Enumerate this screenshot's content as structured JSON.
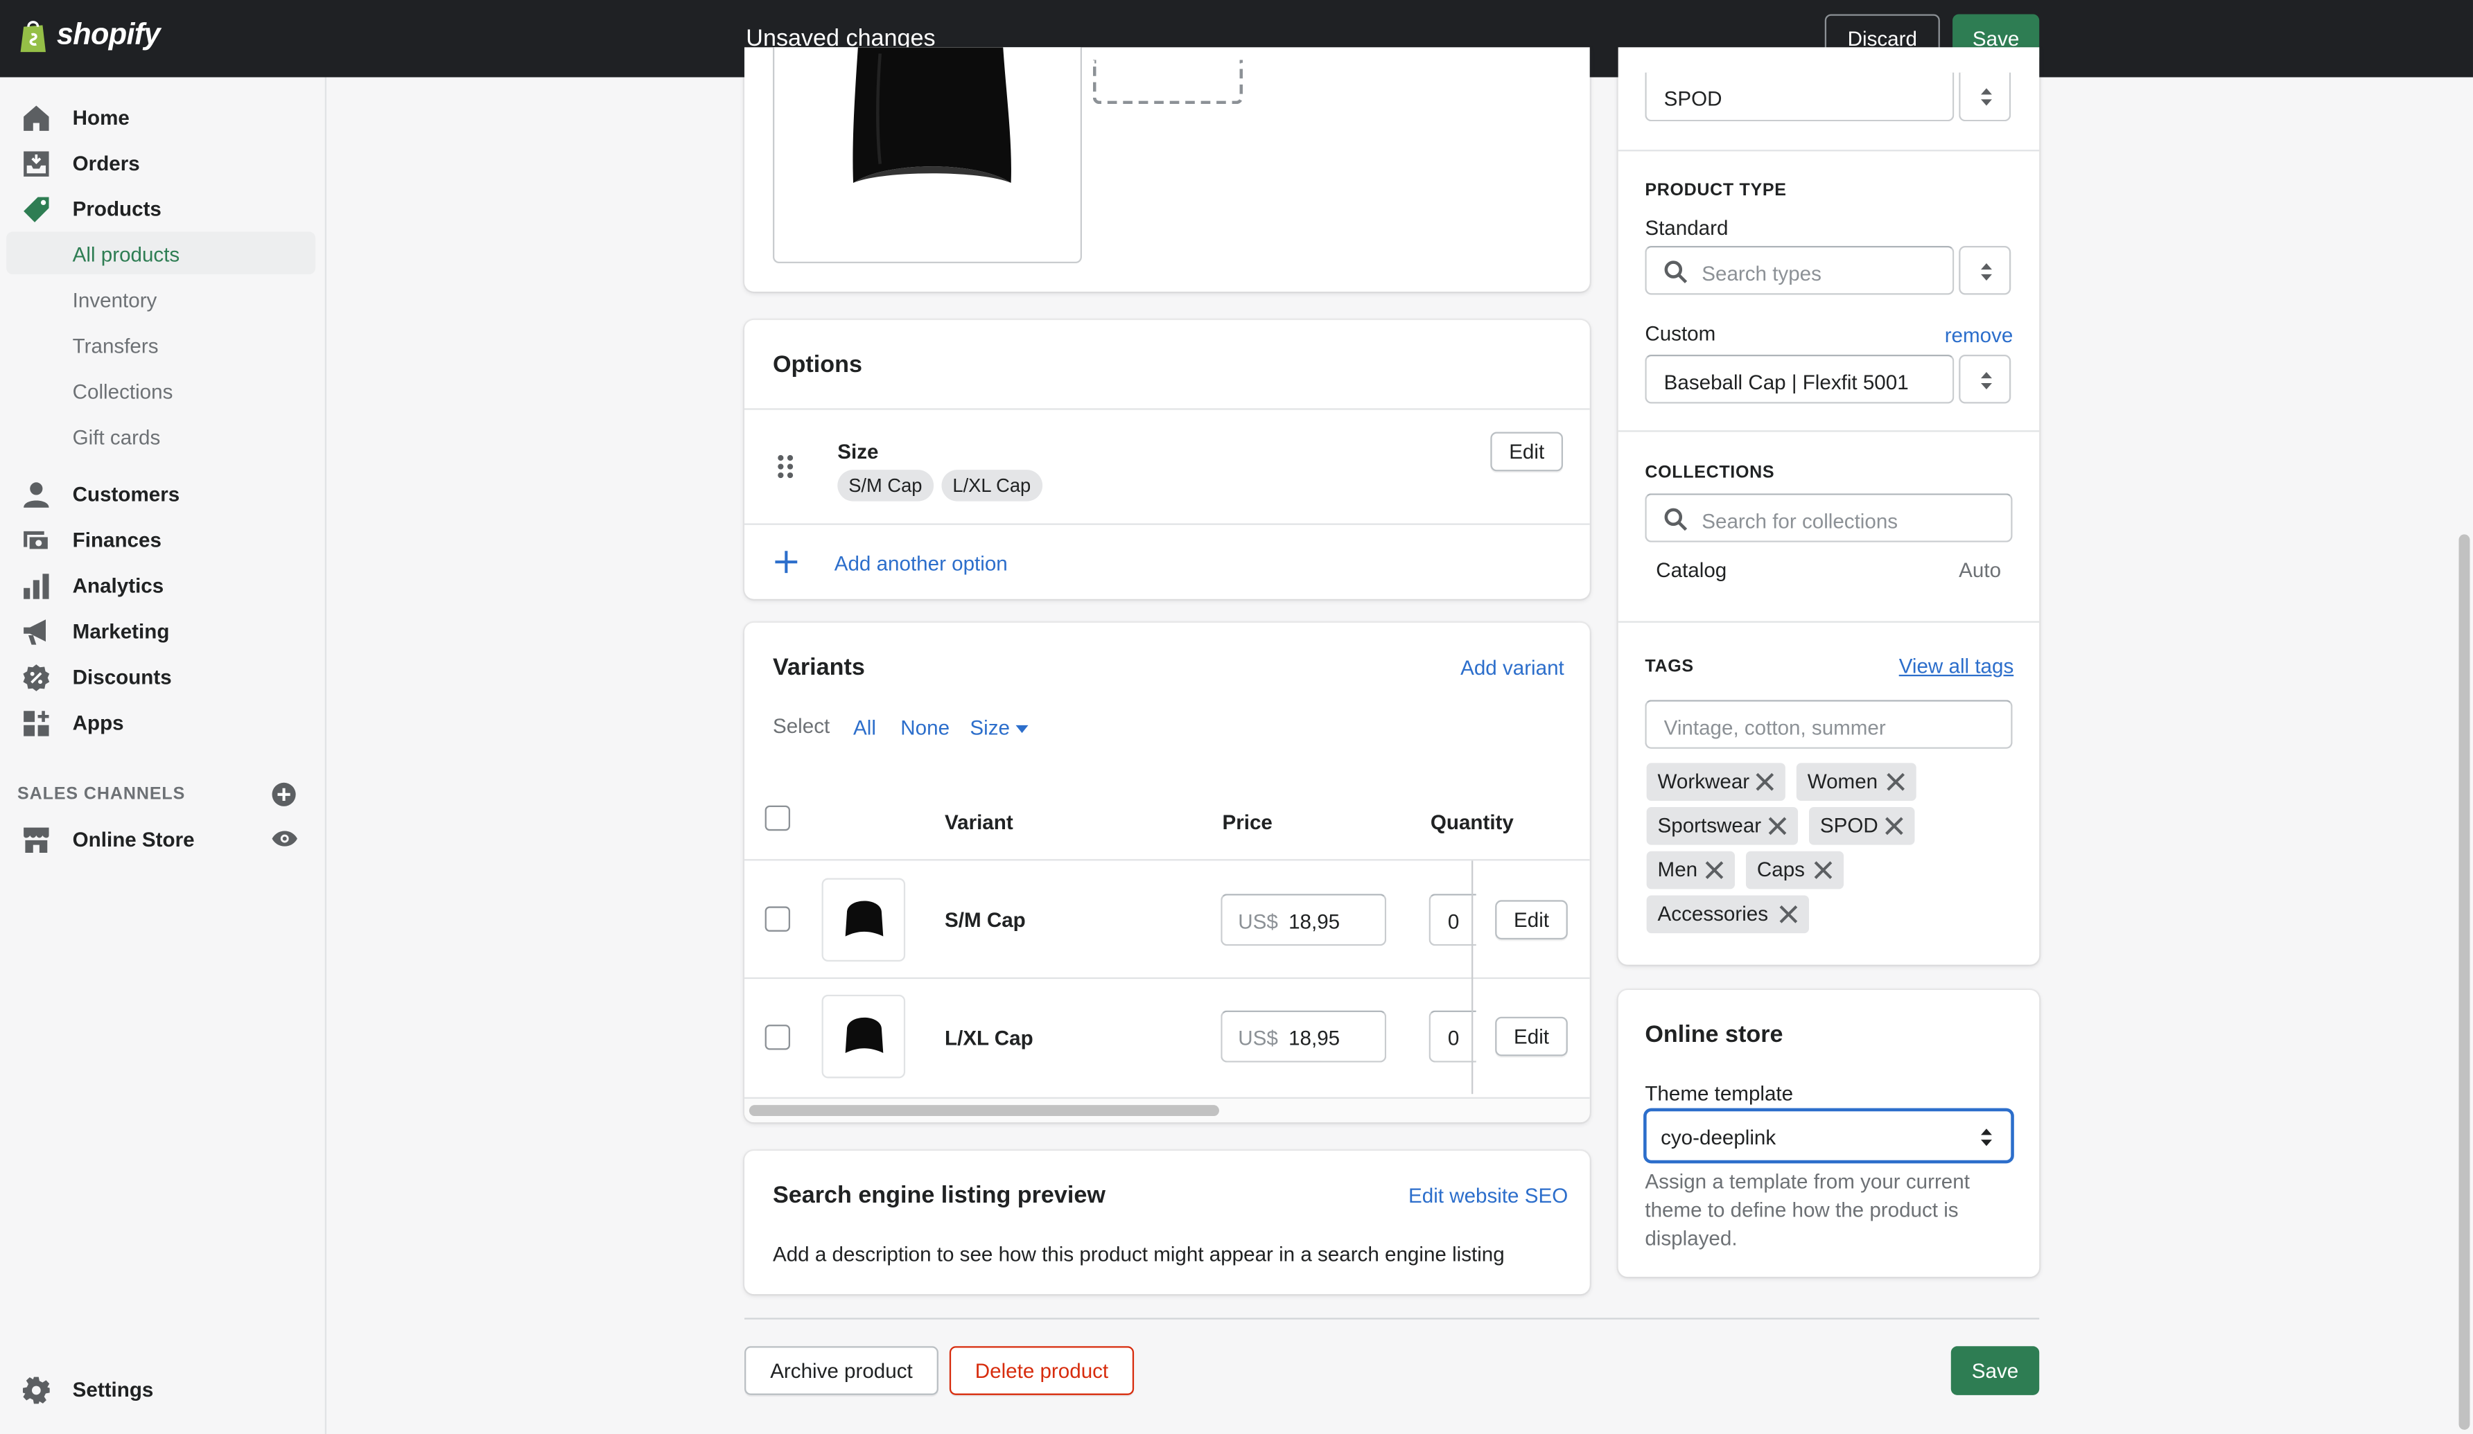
{
  "app": {
    "logo_text": "shopify",
    "status_text": "Unsaved changes",
    "discard_label": "Discard",
    "save_label": "Save"
  },
  "sidebar": {
    "items": [
      {
        "label": "Home",
        "icon": "home-icon"
      },
      {
        "label": "Orders",
        "icon": "orders-icon"
      },
      {
        "label": "Products",
        "icon": "tag-icon"
      },
      {
        "label": "Customers",
        "icon": "person-icon"
      },
      {
        "label": "Finances",
        "icon": "finances-icon"
      },
      {
        "label": "Analytics",
        "icon": "bar-chart-icon"
      },
      {
        "label": "Marketing",
        "icon": "megaphone-icon"
      },
      {
        "label": "Discounts",
        "icon": "discount-icon"
      },
      {
        "label": "Apps",
        "icon": "apps-icon"
      }
    ],
    "product_subitems": [
      "All products",
      "Inventory",
      "Transfers",
      "Collections",
      "Gift cards"
    ],
    "active_subitem": "All products",
    "sales_channels_heading": "SALES CHANNELS",
    "online_store_label": "Online Store",
    "settings_label": "Settings"
  },
  "options": {
    "title": "Options",
    "option_name": "Size",
    "values": [
      "S/M Cap",
      "L/XL Cap"
    ],
    "edit_label": "Edit",
    "add_another_label": "Add another option"
  },
  "variants": {
    "title": "Variants",
    "add_variant_label": "Add variant",
    "select_label": "Select",
    "filter_all": "All",
    "filter_none": "None",
    "filter_size": "Size",
    "columns": [
      "Variant",
      "Price",
      "Quantity"
    ],
    "rows": [
      {
        "name": "S/M Cap",
        "currency": "US$",
        "price": "18,95",
        "quantity": "0",
        "edit": "Edit"
      },
      {
        "name": "L/XL Cap",
        "currency": "US$",
        "price": "18,95",
        "quantity": "0",
        "edit": "Edit"
      }
    ]
  },
  "seo": {
    "title": "Search engine listing preview",
    "edit_label": "Edit website SEO",
    "description": "Add a description to see how this product might appear in a search engine listing"
  },
  "footer": {
    "archive_label": "Archive product",
    "delete_label": "Delete product",
    "save_label": "Save"
  },
  "organization": {
    "vendor_value": "SPOD",
    "product_type_heading": "PRODUCT TYPE",
    "standard_label": "Standard",
    "standard_placeholder": "Search types",
    "custom_label": "Custom",
    "custom_remove": "remove",
    "custom_value": "Baseball Cap | Flexfit 5001",
    "collections_heading": "COLLECTIONS",
    "collections_placeholder": "Search for collections",
    "collection_name": "Catalog",
    "collection_type": "Auto",
    "tags_heading": "TAGS",
    "view_all_tags": "View all tags",
    "tags_placeholder": "Vintage, cotton, summer",
    "tags": [
      "Workwear",
      "Women",
      "Sportswear",
      "SPOD",
      "Men",
      "Caps",
      "Accessories"
    ]
  },
  "online_store": {
    "title": "Online store",
    "theme_label": "Theme template",
    "theme_value": "cyo-deeplink",
    "help_text_1": "Assign a template from your current",
    "help_text_2": "theme to define how the product is",
    "help_text_3": "displayed."
  },
  "colors": {
    "topbar": "#1f2124",
    "primary_green": "#2e7d53",
    "link_blue": "#2c6ecb",
    "danger_red": "#d72c0d"
  }
}
